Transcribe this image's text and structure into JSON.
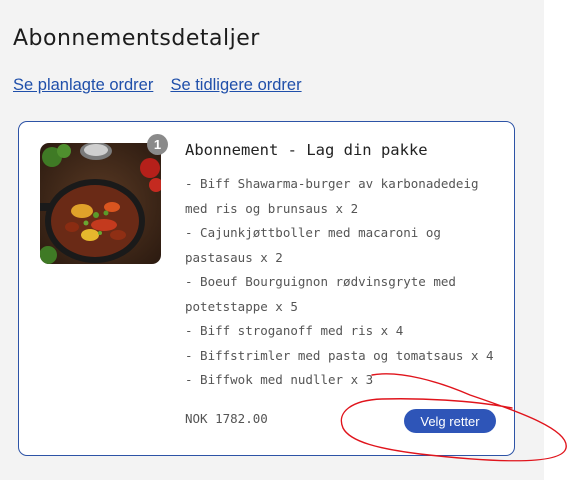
{
  "page": {
    "title": "Abonnementsdetaljer",
    "links": [
      "Se planlagte ordrer",
      "Se tidligere ordrer"
    ]
  },
  "subscription": {
    "badge_count": "1",
    "title": "Abonnement - Lag din pakke",
    "items": [
      "- Biff Shawarma-burger av karbonadedeig med ris og brunsaus x 2",
      "- Cajunkjøttboller med macaroni og pastasaus x 2",
      "- Boeuf Bourguignon rødvinsgryte med potetstappe x 5",
      "- Biff stroganoff med ris x 4",
      "- Biffstrimler med pasta og tomatsaus x 4",
      "- Biffwok med nudller x 3"
    ],
    "price": "NOK 1782.00",
    "button_label": "Velg retter"
  },
  "colors": {
    "link": "#1f4faa",
    "button": "#2e55b8",
    "card_border": "#2d53a6",
    "annotation": "#e0141c"
  },
  "icons": {
    "thumbnail": "food-dish-image"
  }
}
